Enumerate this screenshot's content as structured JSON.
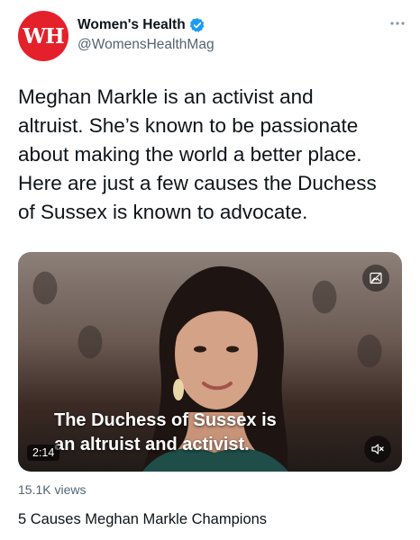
{
  "author": {
    "avatar_text": "WH",
    "name": "Women's Health",
    "handle": "@WomensHealthMag",
    "verified": true
  },
  "menu": {
    "more_icon": "more-horizontal-icon"
  },
  "tweet": {
    "text": "Meghan Markle is an activist and\naltruist. She’s known to be passionate\nabout making the world a better place.\nHere are just a few causes the Duchess\nof Sussex is known to advocate."
  },
  "video": {
    "caption": "The Duchess of Sussex is\nan altruist and activist.",
    "duration": "2:14",
    "views": "15.1K views",
    "title": "5 Causes Meghan Markle Champions",
    "mute_icon": "volume-muted-icon",
    "gif_icon": "image-off-icon"
  },
  "colors": {
    "brand_red": "#e4212b",
    "verified_blue": "#1d9bf0",
    "secondary_text": "#536471"
  }
}
